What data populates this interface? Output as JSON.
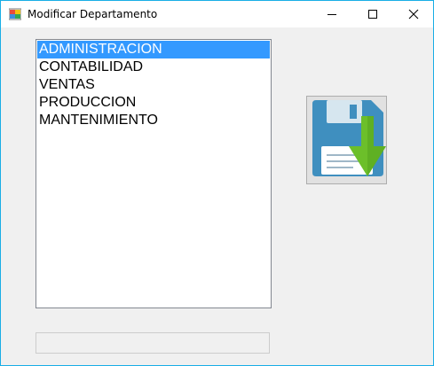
{
  "window": {
    "title": "Modificar Departamento",
    "app_icon": "windows-form-icon",
    "controls": {
      "minimize_icon": "minimize-icon",
      "maximize_icon": "maximize-icon",
      "close_icon": "close-icon"
    },
    "border_color": "#19aee6"
  },
  "departments": {
    "items": [
      "ADMINISTRACION",
      "CONTABILIDAD",
      "VENTAS",
      "PRODUCCION",
      "MANTENIMIENTO"
    ],
    "selected_index": 0,
    "selection_color": "#3399ff"
  },
  "save_button": {
    "icon": "floppy-disk-save-icon"
  },
  "name_field": {
    "value": ""
  }
}
